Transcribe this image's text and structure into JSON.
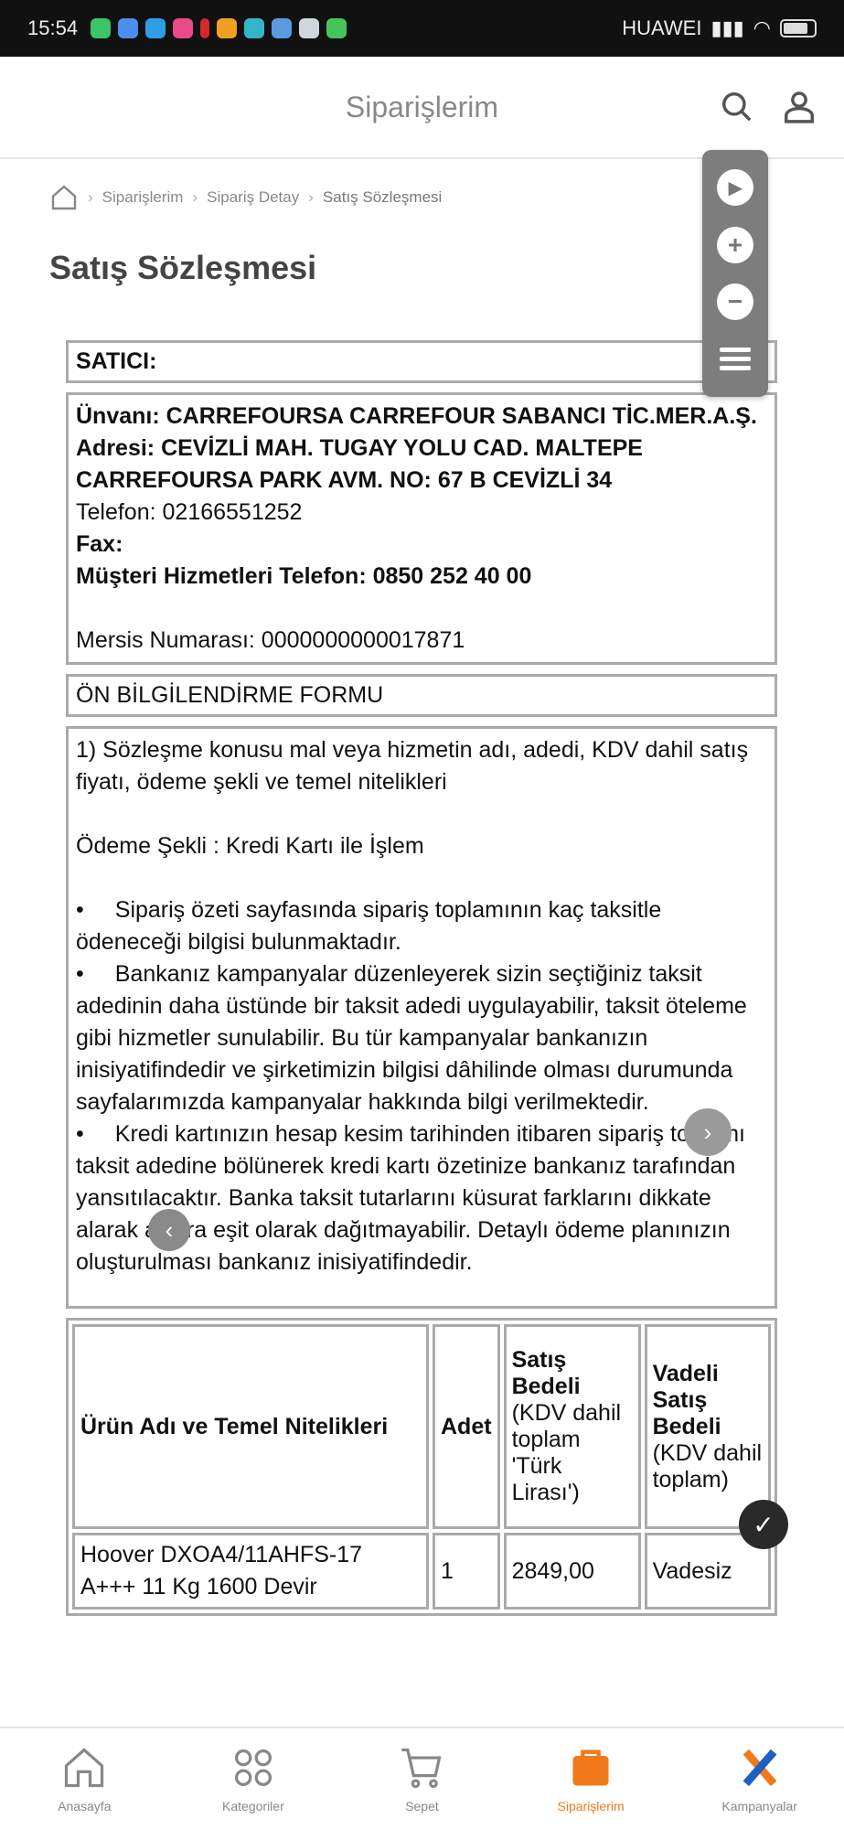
{
  "status_bar": {
    "time": "15:54",
    "carrier": "HUAWEI"
  },
  "header": {
    "title": "Siparişlerim"
  },
  "breadcrumb": {
    "items": [
      "Siparişlerim",
      "Sipariş Detay",
      "Satış Sözleşmesi"
    ]
  },
  "page": {
    "title": "Satış Sözleşmesi"
  },
  "zoom_toolbar": {
    "play": "▸",
    "zoom_in": "+",
    "zoom_out": "−"
  },
  "seller": {
    "header": "SATICI:",
    "unvan": "Ünvanı: CARREFOURSA CARREFOUR SABANCI TİC.MER.A.Ş.",
    "adres": "Adresi: CEVİZLİ MAH. TUGAY YOLU CAD. MALTEPE CARREFOURSA PARK AVM. NO: 67 B CEVİZLİ 34",
    "telefon": "Telefon: 02166551252",
    "fax": "Fax:",
    "musteri": "Müşteri Hizmetleri Telefon: 0850 252 40 00",
    "mersis": "Mersis Numarası: 0000000000017871"
  },
  "form": {
    "header": "ÖN BİLGİLENDİRME FORMU",
    "intro": "1) Sözleşme konusu mal veya hizmetin adı, adedi, KDV dahil satış fiyatı, ödeme şekli ve temel nitelikleri",
    "payment": "Ödeme Şekli : Kredi Kartı ile İşlem",
    "bullets": [
      "Sipariş özeti sayfasında sipariş toplamının kaç taksitle ödeneceği bilgisi bulunmaktadır.",
      "Bankanız kampanyalar düzenleyerek sizin seçtiğiniz taksit adedinin daha üstünde bir taksit adedi uygulayabilir, taksit öteleme gibi hizmetler sunulabilir. Bu tür kampanyalar bankanızın inisiyatifindedir ve şirketimizin bilgisi dâhilinde olması durumunda sayfalarımızda kampanyalar hakkında bilgi verilmektedir.",
      "Kredi kartınızın hesap kesim tarihinden itibaren sipariş toplamı taksit adedine bölünerek kredi kartı özetinize bankanız tarafından yansıtılacaktır. Banka taksit tutarlarını küsurat farklarını dikkate alarak aylara eşit olarak dağıtmayabilir. Detaylı ödeme planınızın oluşturulması bankanız inisiyatifindedir."
    ]
  },
  "products_table": {
    "headers": {
      "name": "Ürün Adı ve Temel Nitelikleri",
      "qty": "Adet",
      "price_bold": "Satış Bedeli",
      "price_light": "(KDV dahil toplam 'Türk Lirası')",
      "term_bold": "Vadeli Satış Bedeli",
      "term_light": "(KDV dahil toplam)"
    },
    "rows": [
      {
        "name": "Hoover DXOA4/11AHFS-17 A+++ 11 Kg 1600 Devir",
        "qty": "1",
        "price": "2849,00",
        "term": "Vadesiz"
      }
    ]
  },
  "bottom_nav": {
    "items": [
      "Anasayfa",
      "Kategoriler",
      "Sepet",
      "Siparişlerim",
      "Kampanyalar"
    ],
    "active_index": 3
  },
  "colors": {
    "accent": "#f07a1a",
    "border": "#aaaaaa",
    "toolbar": "#7d7d7d"
  }
}
